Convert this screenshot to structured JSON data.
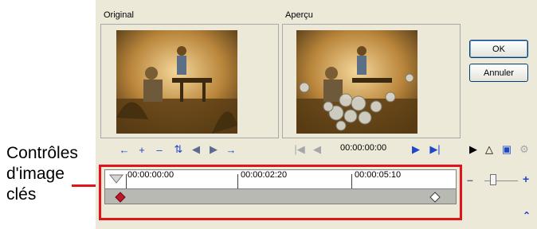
{
  "callout": {
    "line1": "Contrôles",
    "line2": "d'image",
    "line3": "clés"
  },
  "panels": {
    "original_label": "Original",
    "preview_label": "Aperçu"
  },
  "buttons": {
    "ok": "OK",
    "cancel": "Annuler"
  },
  "preview_controls": {
    "timecode": "00:00:00:00"
  },
  "timeline": {
    "ruler_labels": [
      "00:00:00:00",
      "00:00:02:20",
      "00:00:05:10"
    ],
    "keyframe_positions": [
      "00:00:00:00",
      "end"
    ]
  },
  "colors": {
    "accent": "#e2141b",
    "dialog_bg": "#ece9d8",
    "keyframe_selected": "#c0142a"
  },
  "icons": {
    "left_toolbar": [
      "arrow-left-icon",
      "add-keyframe-icon",
      "remove-keyframe-icon",
      "reverse-keyframe-icon",
      "prev-keyframe-icon",
      "next-keyframe-icon",
      "arrow-right-icon"
    ],
    "playback": [
      "go-to-start-icon",
      "previous-frame-icon",
      "next-frame-icon",
      "go-to-end-icon"
    ],
    "right_toolbar": [
      "play-icon",
      "curve-icon",
      "color-icon",
      "settings-icon"
    ]
  }
}
